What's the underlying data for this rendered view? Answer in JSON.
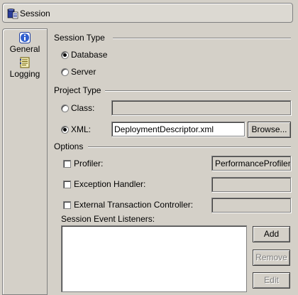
{
  "header": {
    "title": "Session",
    "icon": "session-icon"
  },
  "tabs": [
    {
      "label": "General",
      "icon": "info-icon",
      "selected": true
    },
    {
      "label": "Logging",
      "icon": "logging-icon",
      "selected": false
    }
  ],
  "session_type": {
    "title": "Session Type",
    "options": [
      {
        "label": "Database",
        "checked": true
      },
      {
        "label": "Server",
        "checked": false
      }
    ]
  },
  "project_type": {
    "title": "Project Type",
    "class_label": "Class:",
    "class_value": "",
    "xml_label": "XML:",
    "xml_value": "DeploymentDescriptor.xml",
    "browse_label": "Browse..."
  },
  "options": {
    "title": "Options",
    "profiler_label": "Profiler:",
    "profiler_value": "PerformanceProfiler",
    "exception_label": "Exception Handler:",
    "exception_value": "",
    "etc_label": "External Transaction Controller:",
    "etc_value": "",
    "listeners_label": "Session Event Listeners:",
    "add_label": "Add",
    "remove_label": "Remove",
    "edit_label": "Edit"
  }
}
